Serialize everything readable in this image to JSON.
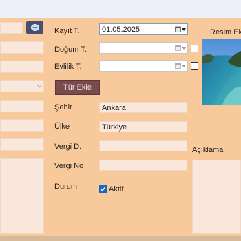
{
  "form": {
    "kayit_label": "Kayıt T.",
    "kayit_value": "01.05.2025",
    "dogum_label": "Doğum T.",
    "dogum_value": "",
    "evlilik_label": "Evlilik T.",
    "evlilik_value": "",
    "tur_ekle_button": "Tür Ekle",
    "sehir_label": "Şehir",
    "sehir_value": "Ankara",
    "ulke_label": "Ülke",
    "ulke_value": "Türkiye",
    "vergi_d_label": "Vergi D.",
    "vergi_d_value": "",
    "vergi_no_label": "Vergi No",
    "vergi_no_value": "",
    "durum_label": "Durum",
    "aktif_label": "Aktif",
    "aktif_checked": true
  },
  "right": {
    "resim_label": "Resim Ek",
    "aciklama_label": "Açıklama"
  },
  "colors": {
    "background": "#f8c99b",
    "field_background": "#fbe8dc",
    "button": "#7a4b4c",
    "search_button": "#4a4e73",
    "checkbox_accent": "#1467c9"
  },
  "icons": {
    "search": "search-icon",
    "calendar": "calendar-icon",
    "dropdown": "chevron-down-icon"
  }
}
